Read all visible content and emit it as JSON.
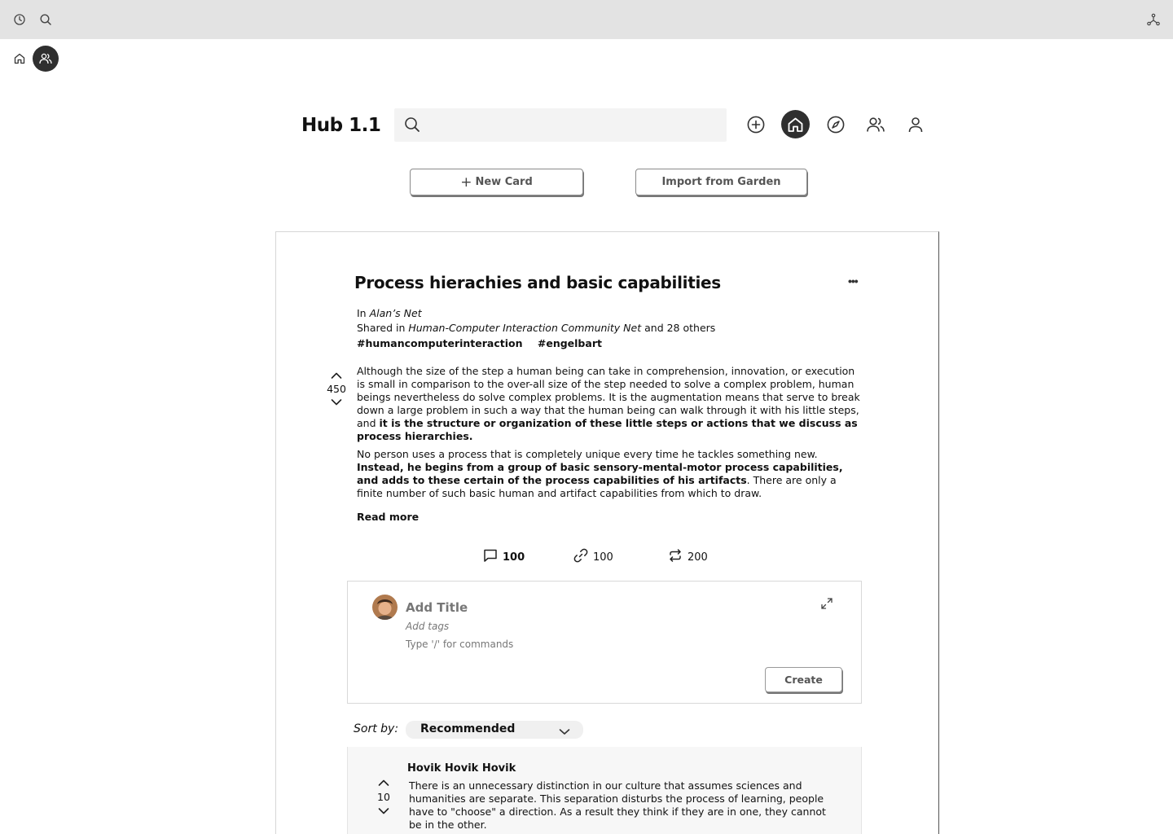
{
  "app": {
    "brand": "Hub 1.1"
  },
  "search": {
    "placeholder": "",
    "value": ""
  },
  "toolbar": {
    "new_card_label": "New Card",
    "import_label": "Import from Garden"
  },
  "card": {
    "title": "Process hierachies and basic capabilities",
    "in_prefix": "In",
    "net": "Alan’s Net",
    "shared_prefix": "Shared in",
    "shared_net": "Human-Computer Interaction Community Net",
    "shared_suffix": "and 28 others",
    "tags": [
      "#humancomputerinteraction",
      "#engelbart"
    ],
    "votes": "450",
    "p1_normal": "Although the size of the step a human being can take in comprehension, innovation, or execution is small in comparison to the over-all size of the step needed to solve a complex problem, human beings nevertheless do solve complex problems. It is the augmentation means that serve to break down a large problem in such a way that the human being can walk through it with his little steps, and ",
    "p1_bold": "it is the structure or organization of these little steps or actions that we discuss as process hierarchies.",
    "p2_normal1": "No person uses a process that is completely unique every time he tackles something new. ",
    "p2_bold": "Instead, he begins from a group of basic sensory-mental-motor process capabilities, and adds to these certain of the process capabilities of his artifacts",
    "p2_normal2": ". There are only a finite number of such basic human and artifact capabilities from which to draw.",
    "read_more": "Read more",
    "stats": {
      "comments": "100",
      "links": "100",
      "reposts": "200"
    }
  },
  "composer": {
    "title_placeholder": "Add Title",
    "tags_placeholder": "Add tags",
    "body_placeholder": "Type '/' for commands",
    "create_label": "Create"
  },
  "sort": {
    "label": "Sort by:",
    "value": "Recommended"
  },
  "comment": {
    "author": "Hovik Hovik Hovik",
    "votes": "10",
    "body": "There is an unnecessary distinction in our culture that assumes sciences and humanities are separate. This separation disturbs the process of learning, people have to \"choose\" a direction. As a result they think if they are in one, they cannot be in the other."
  },
  "colors": {
    "dark": "#2f2f2f",
    "topbar": "#e3e3e3",
    "search_bg": "#f3f3f3"
  }
}
